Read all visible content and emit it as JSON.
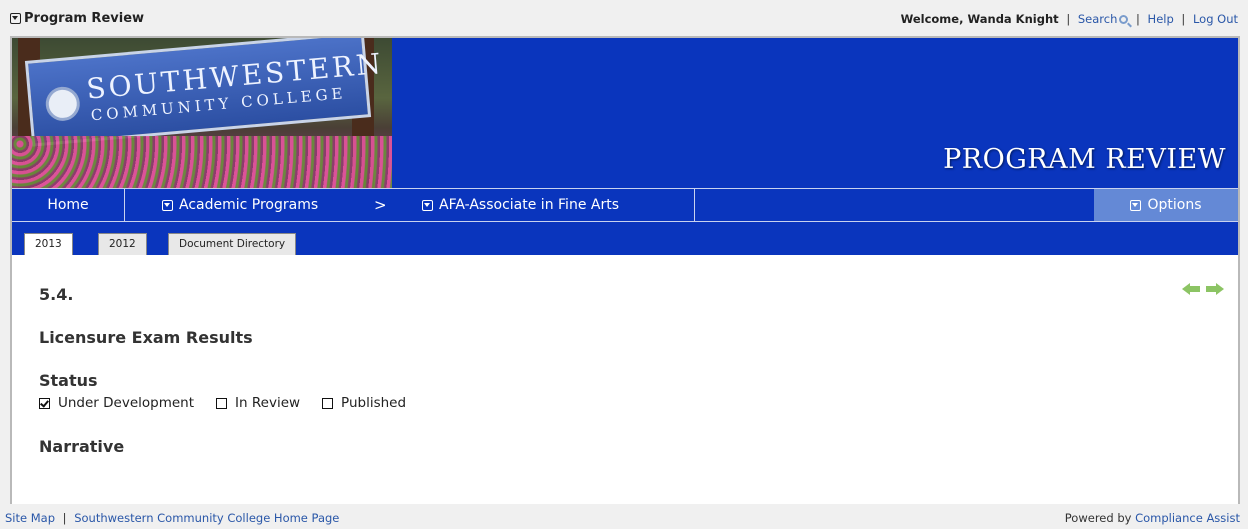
{
  "header": {
    "app_title": "Program Review",
    "welcome": "Welcome, Wanda Knight",
    "links": {
      "search": "Search",
      "help": "Help",
      "logout": "Log Out"
    },
    "separator": "|"
  },
  "banner": {
    "sign_line1": "SOUTHWESTERN",
    "sign_line2": "COMMUNITY COLLEGE",
    "title": "PROGRAM REVIEW"
  },
  "nav": {
    "home": "Home",
    "programs": "Academic Programs",
    "arrow": ">",
    "program": "AFA-Associate in Fine Arts",
    "options": "Options"
  },
  "tabs": [
    {
      "label": "2013",
      "active": true
    },
    {
      "label": "2012",
      "active": false
    },
    {
      "label": "Document Directory",
      "active": false
    }
  ],
  "content": {
    "section_number": "5.4.",
    "section_title": "Licensure Exam Results",
    "status_heading": "Status",
    "status_options": [
      {
        "label": "Under Development",
        "checked": true
      },
      {
        "label": "In Review",
        "checked": false
      },
      {
        "label": "Published",
        "checked": false
      }
    ],
    "narrative_heading": "Narrative"
  },
  "footer": {
    "site_map": "Site Map",
    "separator": "|",
    "home_page": "Southwestern Community College Home Page",
    "powered_by": "Powered by",
    "powered_link": "Compliance Assist"
  },
  "colors": {
    "banner_blue": "#0a35bd",
    "options_bg": "#6489d6",
    "link": "#2a57a8",
    "arrow_green": "#8cc464"
  }
}
